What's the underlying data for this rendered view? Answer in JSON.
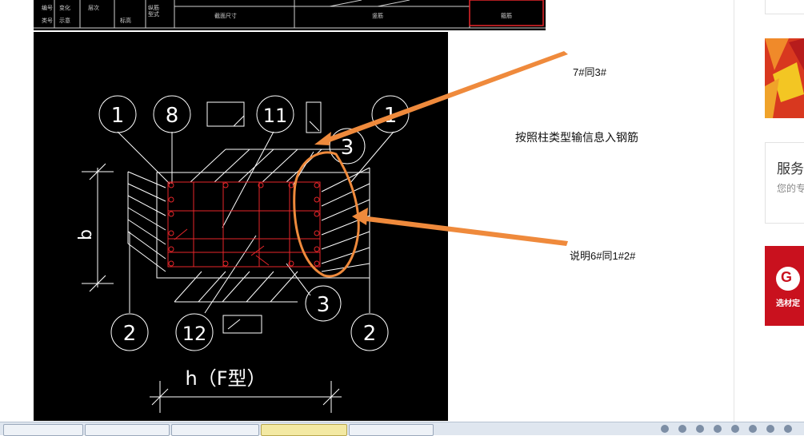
{
  "cad_header": {
    "columns": [
      "编号",
      "类号",
      "变化",
      "示意",
      "层次",
      "标高",
      "纵筋",
      "型式",
      "截面尺寸",
      "竖筋",
      "箍筋"
    ]
  },
  "drawing": {
    "dimension_b": "b",
    "dimension_h": "h（F型）",
    "markers": {
      "top_left_1": "1",
      "top_8": "8",
      "top_11": "11",
      "top_right_1": "1",
      "right_3_top": "3",
      "right_3_bottom": "3",
      "bottom_left_2": "2",
      "bottom_12": "12",
      "bottom_right_2": "2"
    },
    "colors": {
      "background": "#000000",
      "lines": "#ffffff",
      "rebar": "#e8262a",
      "highlight": "#ef8a3c"
    }
  },
  "annotations": {
    "top": "7#同3#",
    "middle": "按照柱类型输信息入钢筋",
    "bottom": "说明6#同1#2#"
  },
  "sidebar": {
    "service": {
      "title": "服务",
      "desc": "您的专家"
    },
    "brand": {
      "text": "选材定",
      "logo_icon": "g-logo-icon"
    }
  },
  "taskbar": {
    "tasks": [
      "task-1",
      "task-2",
      "task-3",
      "task-4",
      "task-5"
    ]
  }
}
